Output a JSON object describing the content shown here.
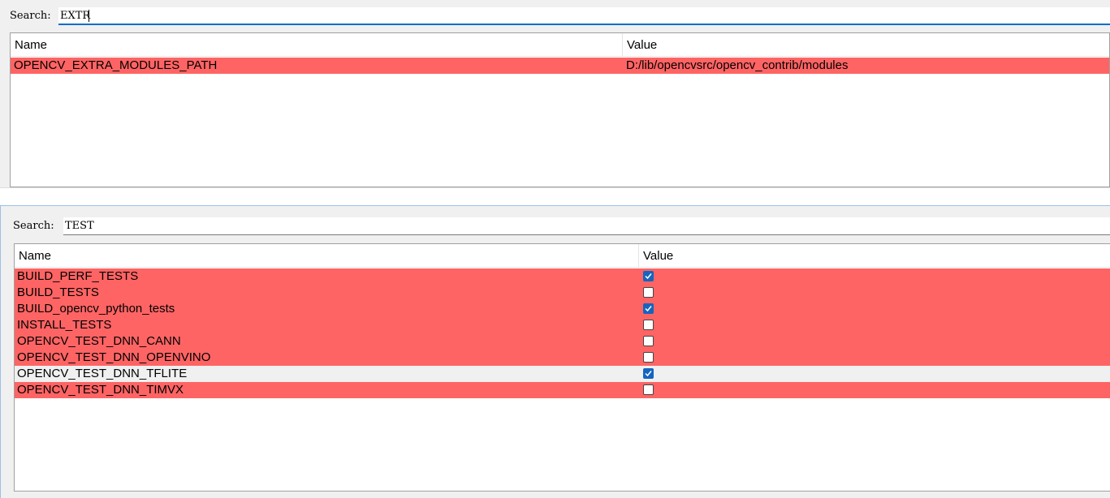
{
  "panels": [
    {
      "search": {
        "label": "Search:",
        "value": "EXTR"
      },
      "headers": {
        "name": "Name",
        "value": "Value"
      },
      "rows": [
        {
          "name": "OPENCV_EXTRA_MODULES_PATH",
          "value": "D:/lib/opencvsrc/opencv_contrib/modules"
        }
      ]
    },
    {
      "search": {
        "label": "Search:",
        "value": "TEST"
      },
      "headers": {
        "name": "Name",
        "value": "Value"
      },
      "rows": [
        {
          "name": "BUILD_PERF_TESTS",
          "checked": true
        },
        {
          "name": "BUILD_TESTS",
          "checked": false
        },
        {
          "name": "BUILD_opencv_python_tests",
          "checked": true
        },
        {
          "name": "INSTALL_TESTS",
          "checked": false
        },
        {
          "name": "OPENCV_TEST_DNN_CANN",
          "checked": false
        },
        {
          "name": "OPENCV_TEST_DNN_OPENVINO",
          "checked": false
        },
        {
          "name": "OPENCV_TEST_DNN_TFLITE",
          "checked": true
        },
        {
          "name": "OPENCV_TEST_DNN_TIMVX",
          "checked": false
        }
      ]
    }
  ],
  "edge_glyph": "e",
  "colors": {
    "changed_row": "#ff6464",
    "unchanged_row": "#f0f0f0",
    "checkbox_checked": "#1565c0",
    "search_focus": "#0b6fc7"
  }
}
